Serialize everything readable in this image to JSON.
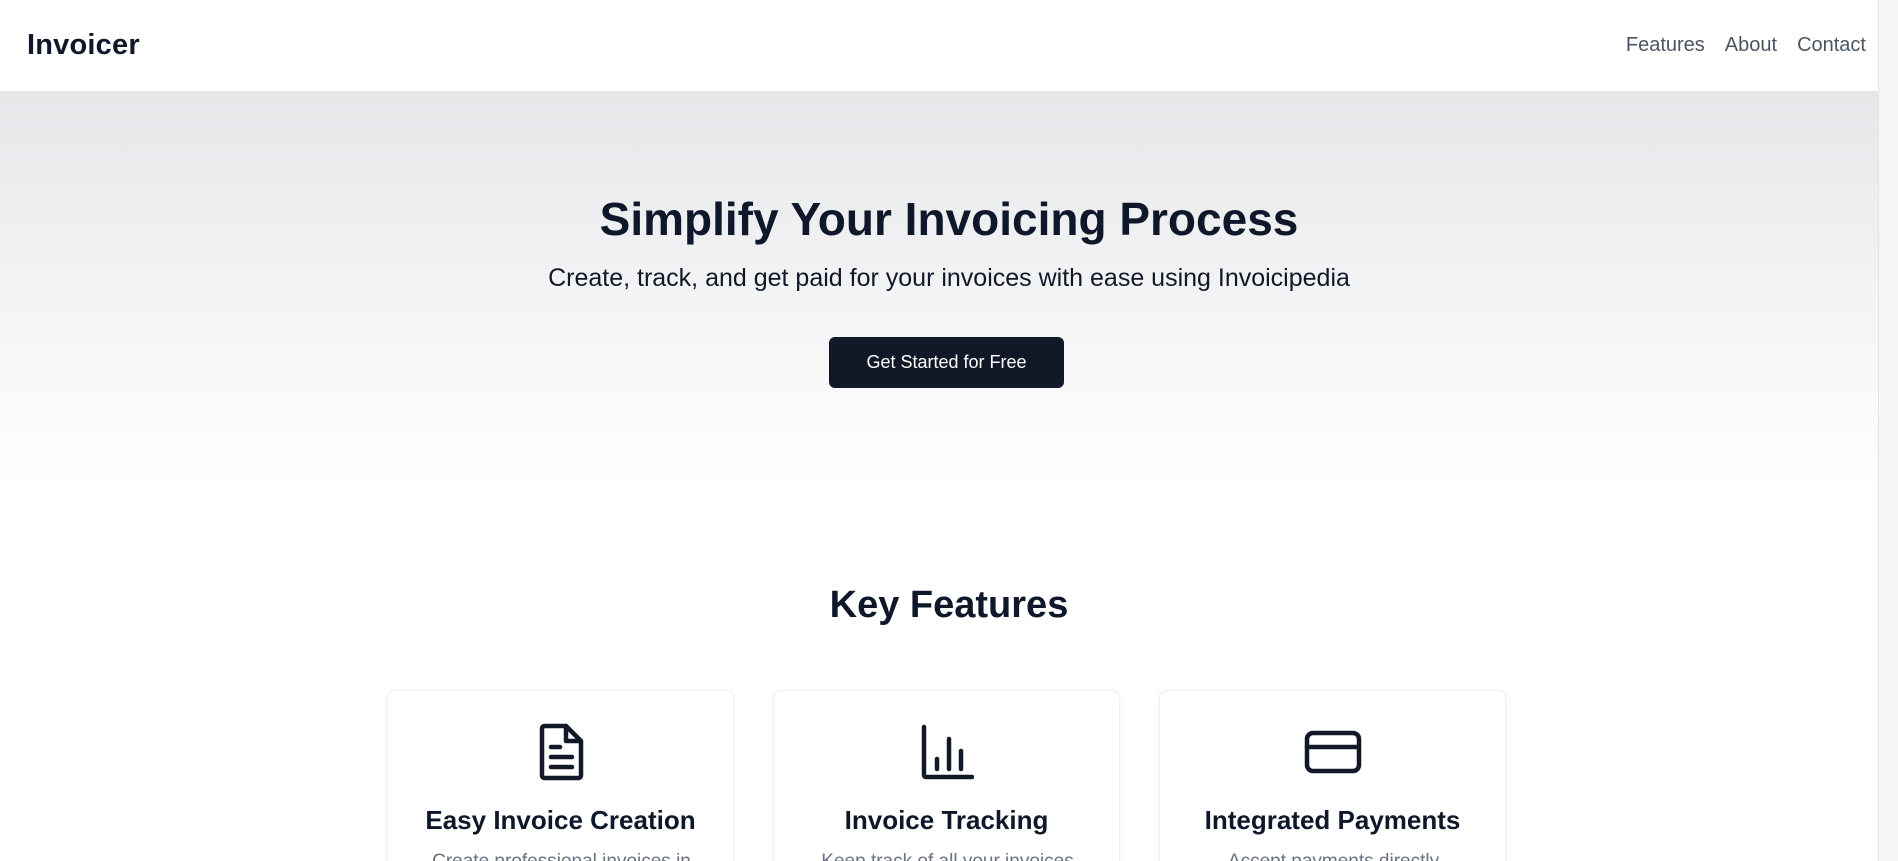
{
  "header": {
    "brand": "Invoicer",
    "nav": [
      "Features",
      "About",
      "Contact"
    ]
  },
  "hero": {
    "title": "Simplify Your Invoicing Process",
    "subtitle": "Create, track, and get paid for your invoices with ease using Invoicipedia",
    "cta_label": "Get Started for Free"
  },
  "features": {
    "title": "Key Features",
    "cards": [
      {
        "icon": "document-icon",
        "title": "Easy Invoice Creation",
        "desc": "Create professional invoices in"
      },
      {
        "icon": "bar-chart-icon",
        "title": "Invoice Tracking",
        "desc": "Keep track of all your invoices"
      },
      {
        "icon": "credit-card-icon",
        "title": "Integrated Payments",
        "desc": "Accept payments directly"
      }
    ]
  },
  "colors": {
    "primary": "#111827",
    "text_muted": "#6b7280",
    "nav_text": "#4b5563"
  }
}
